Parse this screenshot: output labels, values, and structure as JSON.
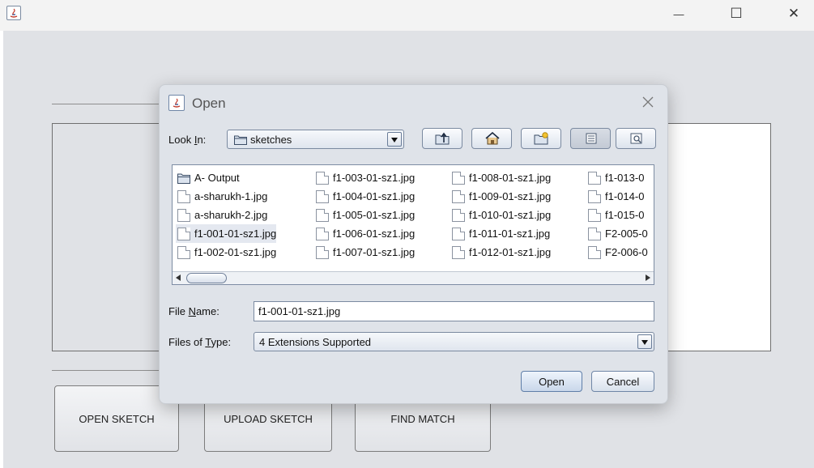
{
  "window": {
    "minimize_glyph": "—",
    "maximize_glyph": "☐",
    "close_glyph": "✕"
  },
  "main_buttons": {
    "open_sketch": "OPEN SKETCH",
    "upload_sketch": "UPLOAD SKETCH",
    "find_match": "FIND MATCH"
  },
  "dialog": {
    "title": "Open",
    "look_in_label": "Look In:",
    "look_in_mnemonic": "I",
    "look_in_value": "sketches",
    "toolbar_icons": [
      "up-one-level-icon",
      "home-icon",
      "new-folder-icon",
      "list-view-icon",
      "details-view-icon"
    ],
    "files": [
      [
        "A- Output",
        "a-sharukh-1.jpg",
        "a-sharukh-2.jpg",
        "f1-001-01-sz1.jpg",
        "f1-002-01-sz1.jpg"
      ],
      [
        "f1-003-01-sz1.jpg",
        "f1-004-01-sz1.jpg",
        "f1-005-01-sz1.jpg",
        "f1-006-01-sz1.jpg",
        "f1-007-01-sz1.jpg"
      ],
      [
        "f1-008-01-sz1.jpg",
        "f1-009-01-sz1.jpg",
        "f1-010-01-sz1.jpg",
        "f1-011-01-sz1.jpg",
        "f1-012-01-sz1.jpg"
      ],
      [
        "f1-013-0",
        "f1-014-0",
        "f1-015-0",
        "F2-005-0",
        "F2-006-0"
      ]
    ],
    "selected_file": "f1-001-01-sz1.jpg",
    "file_name_label_pre": "File ",
    "file_name_label_mnemonic": "N",
    "file_name_label_post": "ame:",
    "file_name_value": "f1-001-01-sz1.jpg",
    "files_of_type_label_pre": "Files of ",
    "files_of_type_label_mnemonic": "T",
    "files_of_type_label_post": "ype:",
    "files_of_type_value": "4 Extensions Supported",
    "open_button": "Open",
    "cancel_button": "Cancel",
    "accent_color": "#5f7ea8"
  }
}
